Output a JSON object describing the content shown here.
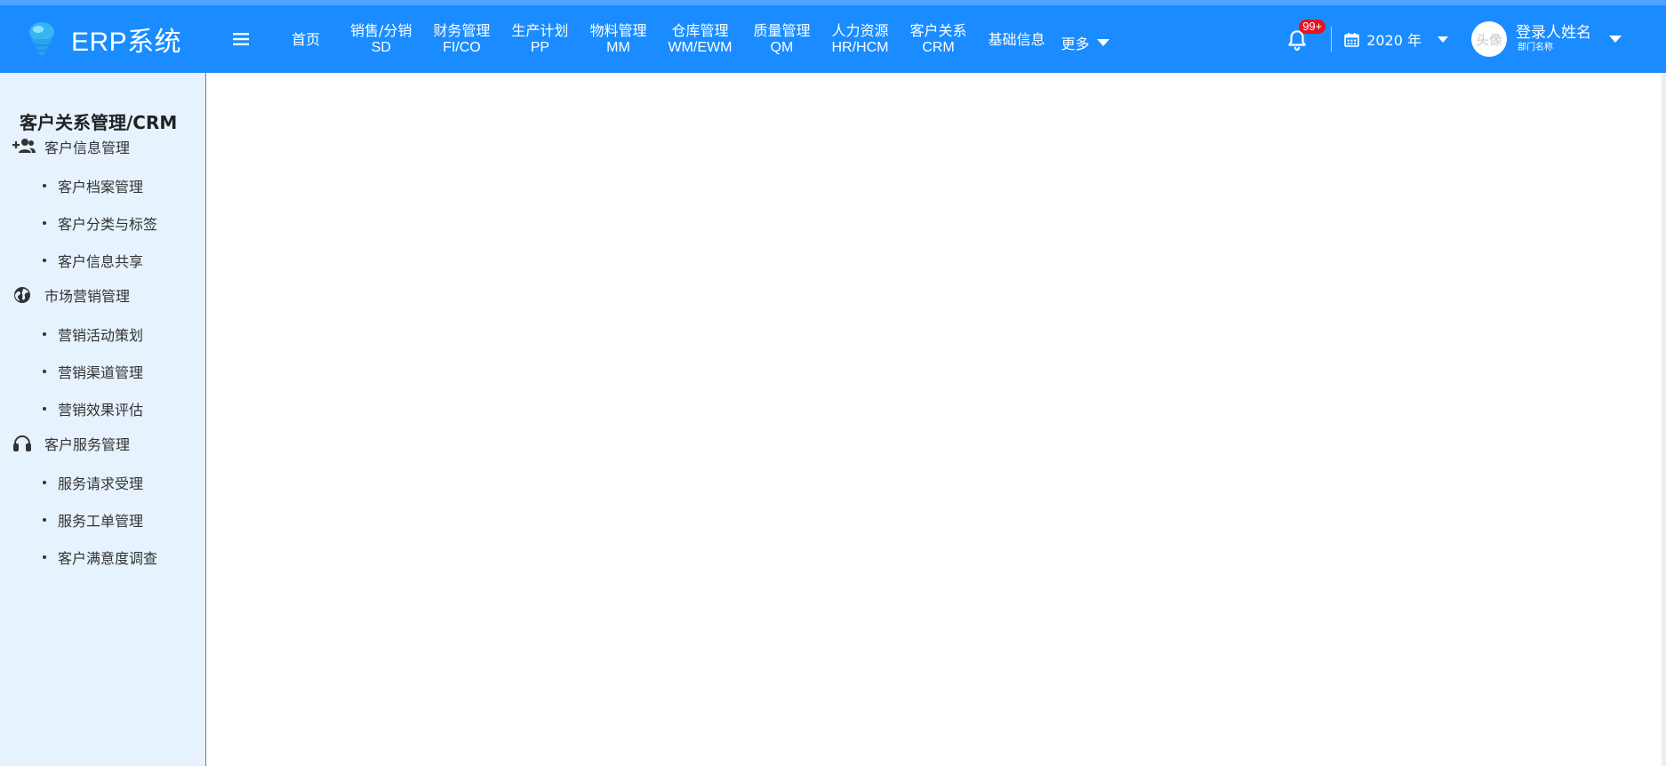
{
  "app": {
    "title": "ERP系统"
  },
  "colors": {
    "header": "#1a8cff",
    "sidebar": "#e6f2fd",
    "badge": "#e81123"
  },
  "header": {
    "menu_icon": "hamburger-icon",
    "nav": [
      {
        "label": "首页"
      },
      {
        "label": "销售/分销",
        "sub": "SD"
      },
      {
        "label": "财务管理",
        "sub": "FI/CO"
      },
      {
        "label": "生产计划",
        "sub": "PP"
      },
      {
        "label": "物料管理",
        "sub": "MM"
      },
      {
        "label": "仓库管理",
        "sub": "WM/EWM"
      },
      {
        "label": "质量管理",
        "sub": "QM"
      },
      {
        "label": "人力资源",
        "sub": "HR/HCM"
      },
      {
        "label": "客户关系",
        "sub": "CRM"
      },
      {
        "label": "基础信息"
      }
    ],
    "more_label": "更多",
    "notifications": {
      "badge": "99+"
    },
    "year_label": "2020 年",
    "user": {
      "avatar_text": "头像",
      "name": "登录人姓名",
      "dept": "部门名称"
    }
  },
  "sidebar": {
    "title": "客户关系管理/CRM",
    "groups": [
      {
        "label": "客户信息管理",
        "icon": "user-add-icon",
        "items": [
          "客户档案管理",
          "客户分类与标签",
          "客户信息共享"
        ]
      },
      {
        "label": "市场营销管理",
        "icon": "globe-icon",
        "items": [
          "营销活动策划",
          "营销渠道管理",
          "营销效果评估"
        ]
      },
      {
        "label": "客户服务管理",
        "icon": "headset-icon",
        "items": [
          "服务请求受理",
          "服务工单管理",
          "客户满意度调查"
        ]
      }
    ]
  }
}
